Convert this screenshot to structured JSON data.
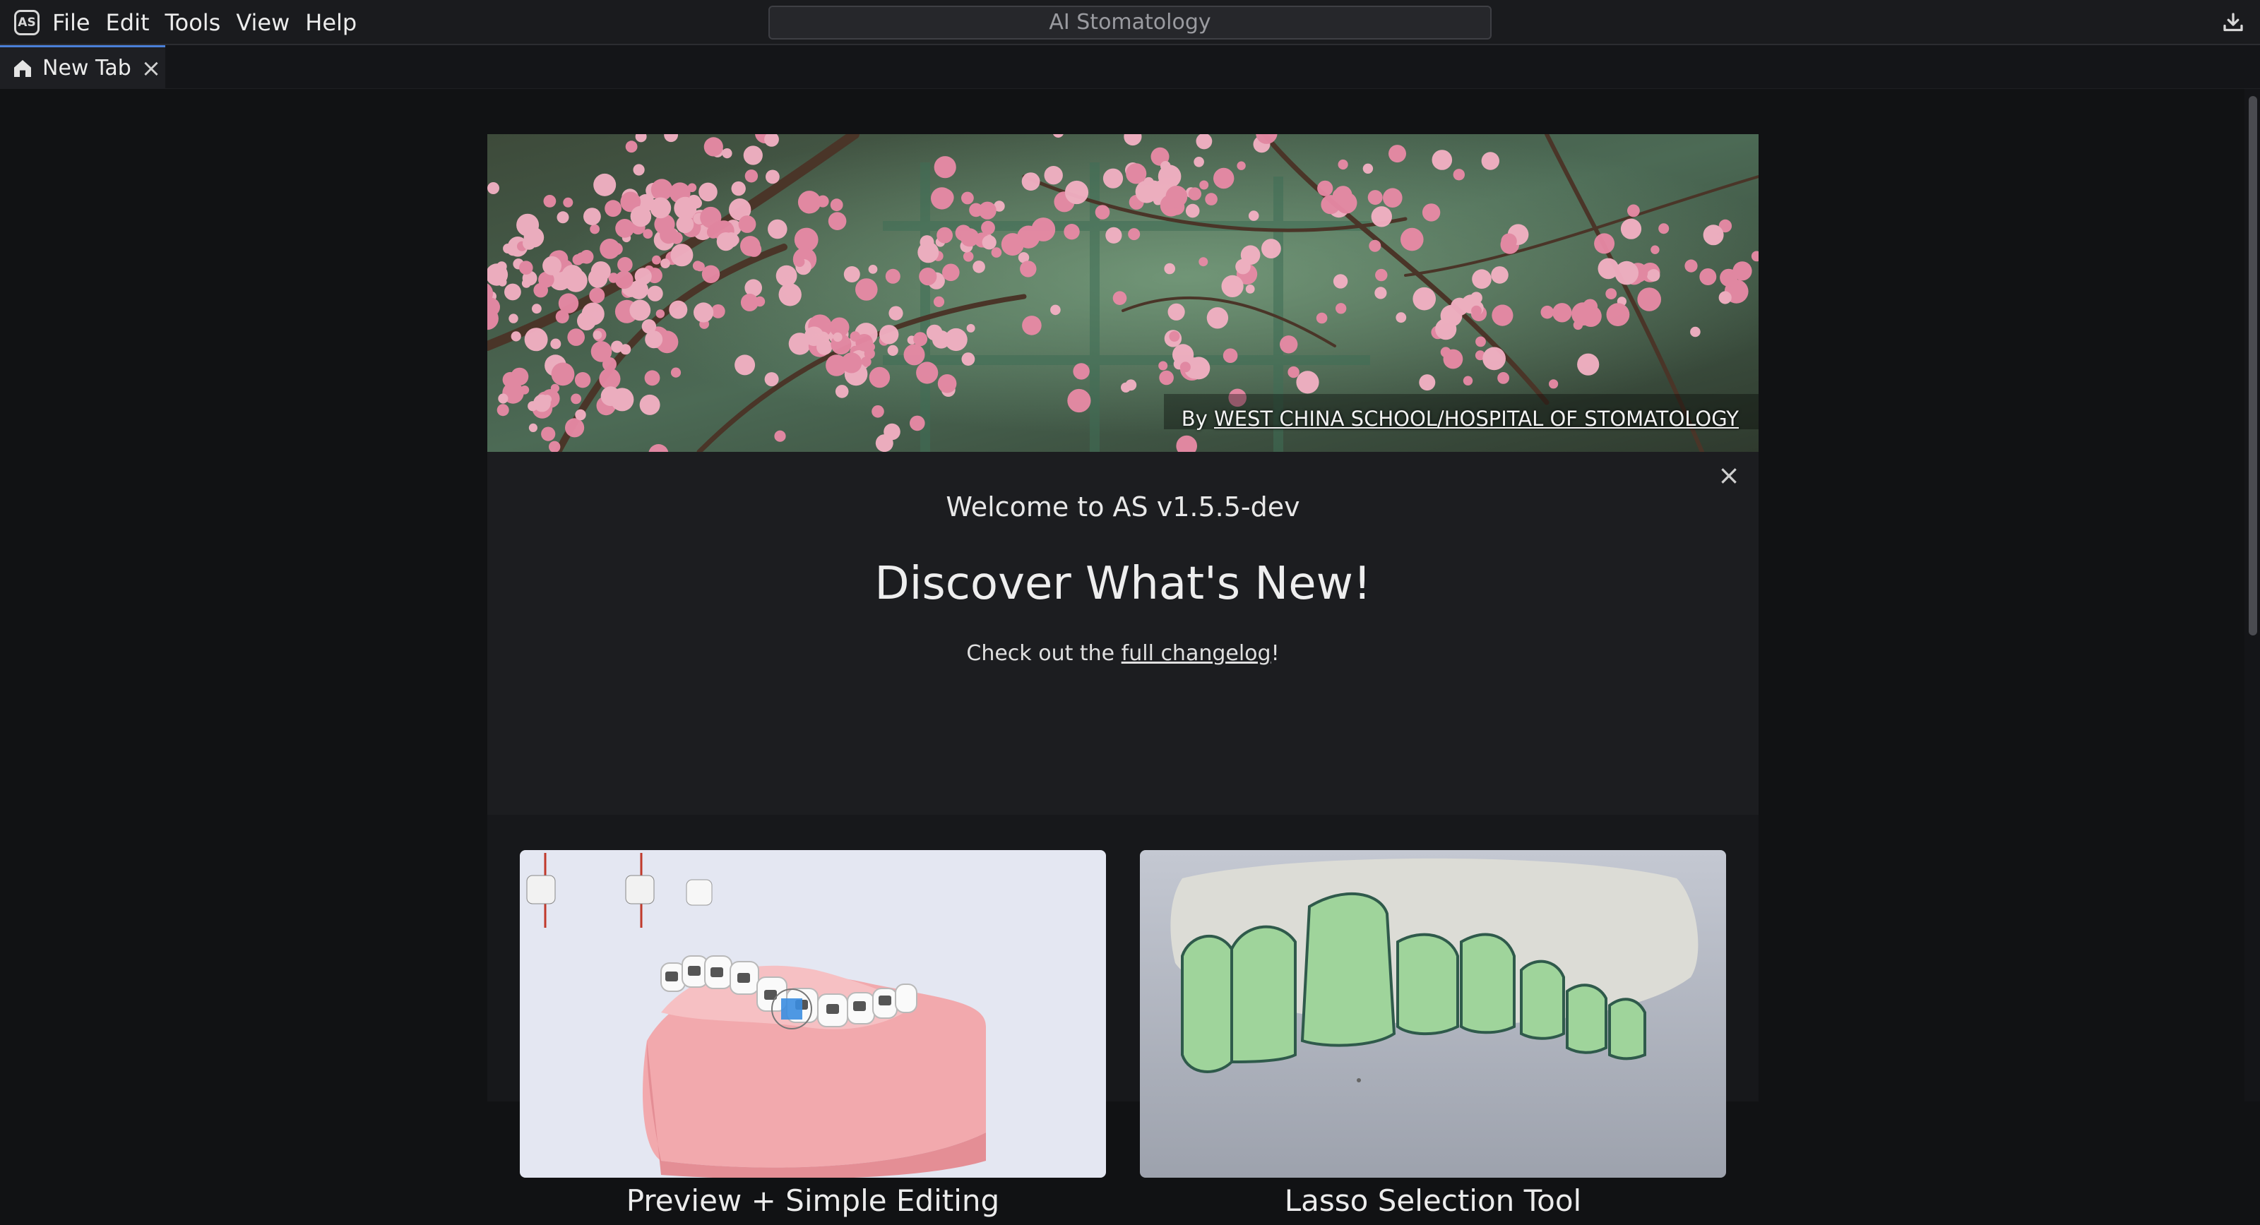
{
  "app": {
    "logo_text": "AS",
    "title": "AI Stomatology"
  },
  "menu": {
    "items": [
      "File",
      "Edit",
      "Tools",
      "View",
      "Help"
    ]
  },
  "tabs": [
    {
      "label": "New Tab",
      "icon": "home-icon",
      "active": true
    }
  ],
  "hero": {
    "credit_prefix": "By ",
    "credit_link": "WEST CHINA SCHOOL/HOSPITAL OF STOMATOLOGY"
  },
  "welcome": {
    "version_line": "Welcome to AS v1.5.5-dev",
    "headline": "Discover What's New!",
    "changelog_prefix": "Check out the ",
    "changelog_link": "full changelog",
    "changelog_suffix": "!"
  },
  "features": [
    {
      "title": "Preview + Simple Editing",
      "description": ""
    },
    {
      "title": "Lasso Selection Tool",
      "description": ""
    }
  ],
  "colors": {
    "accent": "#4a7fd8",
    "titlebar_bg": "#1a1b1e",
    "content_bg": "#111214",
    "panel_bg": "#1c1d20"
  }
}
